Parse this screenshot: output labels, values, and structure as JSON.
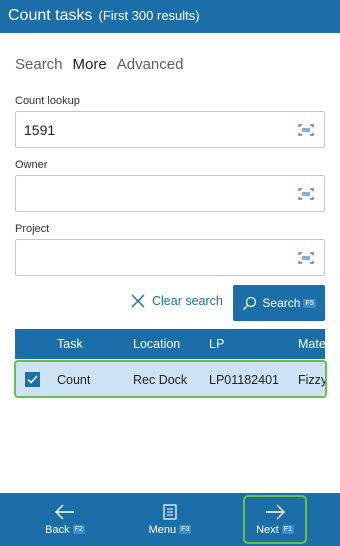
{
  "header": {
    "title": "Count tasks",
    "subtitle": "(First 300 results)"
  },
  "tabs": [
    {
      "label": "Search",
      "active": false
    },
    {
      "label": "More",
      "active": true
    },
    {
      "label": "Advanced",
      "active": false
    }
  ],
  "fields": {
    "count_lookup": {
      "label": "Count lookup",
      "value": "1591"
    },
    "owner": {
      "label": "Owner",
      "value": ""
    },
    "project": {
      "label": "Project",
      "value": ""
    }
  },
  "actions": {
    "clear_label": "Clear search",
    "search_label": "Search",
    "search_key": "F5"
  },
  "grid": {
    "columns": [
      "Task",
      "Location",
      "LP",
      "Mate"
    ],
    "rows": [
      {
        "checked": true,
        "task": "Count",
        "location": "Rec Dock",
        "lp": "LP01182401",
        "material": "Fizzy"
      }
    ]
  },
  "footer": {
    "back": {
      "label": "Back",
      "key": "F2"
    },
    "menu": {
      "label": "Menu",
      "key": "F3"
    },
    "next": {
      "label": "Next",
      "key": "F1"
    }
  },
  "colors": {
    "primary": "#1b6ea8",
    "selected_row": "#cde3f3",
    "highlight": "#6abf4b"
  },
  "icons": [
    "barcode-scan-icon",
    "close-icon",
    "search-icon",
    "checkmark-icon",
    "arrow-left-icon",
    "menu-list-icon",
    "arrow-right-icon"
  ]
}
